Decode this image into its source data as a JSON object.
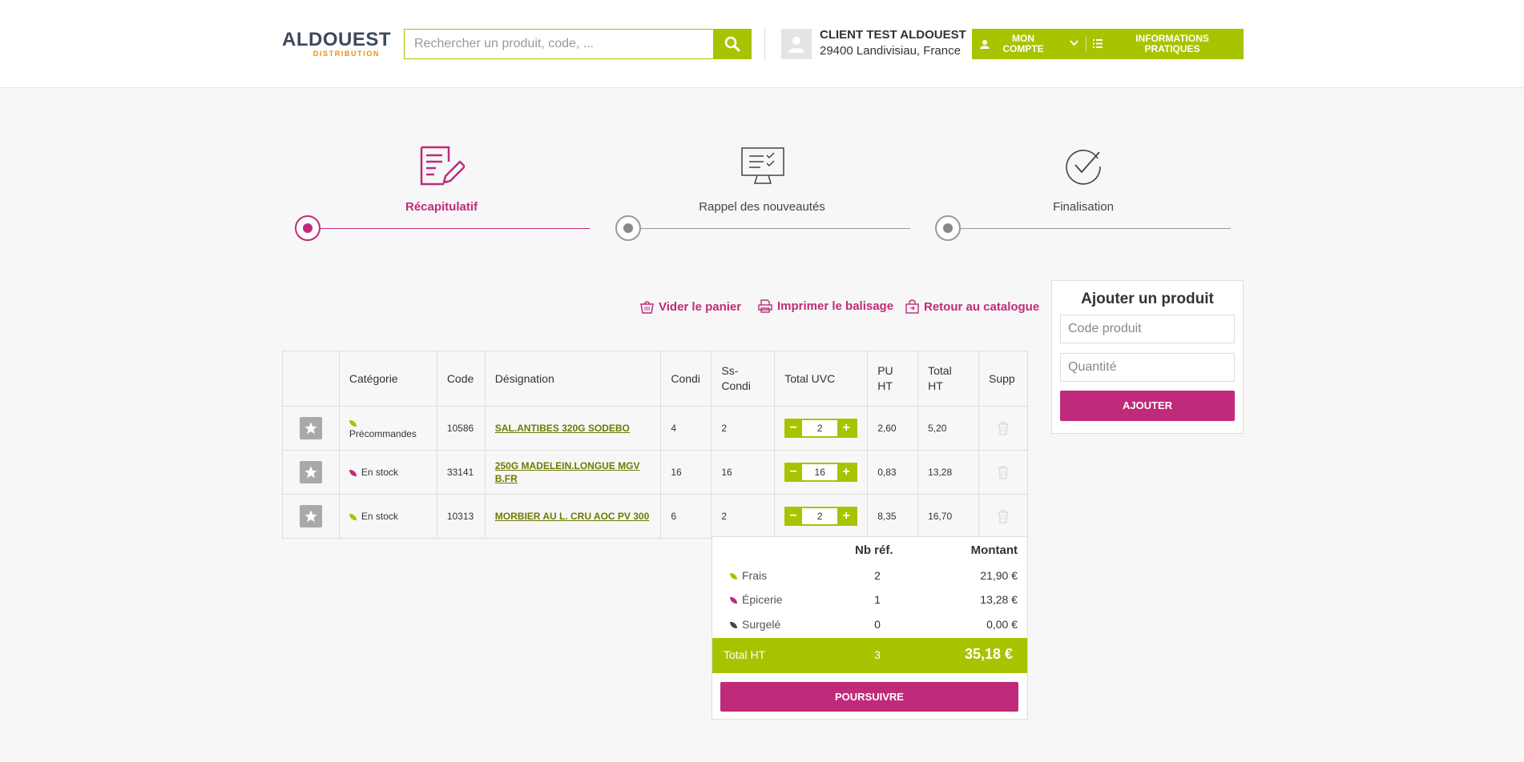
{
  "header": {
    "logo_main": "ALDOUEST",
    "logo_sub": "DISTRIBUTION",
    "search_placeholder": "Rechercher un produit, code, ...",
    "client_name": "CLIENT TEST ALDOUEST",
    "client_address": "29400 Landivisiau, France",
    "account_label": "MON COMPTE",
    "info_label": "INFORMATIONS PRATIQUES"
  },
  "steps": [
    {
      "label": "Récapitulatif",
      "active": true
    },
    {
      "label": "Rappel des nouveautés",
      "active": false
    },
    {
      "label": "Finalisation",
      "active": false
    }
  ],
  "actions": {
    "empty_cart": "Vider le panier",
    "print_labels": "Imprimer le balisage",
    "back_catalog": "Retour au catalogue"
  },
  "table": {
    "headers": [
      "",
      "Catégorie",
      "Code",
      "Désignation",
      "Condi",
      "Ss-Condi",
      "Total UVC",
      "PU HT",
      "Total HT",
      "Supp"
    ],
    "rows": [
      {
        "category": "Précommandes",
        "category_color": "#a8c300",
        "code": "10586",
        "designation": "SAL.ANTIBES 320G SODEBO",
        "condi": "4",
        "ss_condi": "2",
        "qty": "2",
        "pu_ht": "2,60",
        "total_ht": "5,20"
      },
      {
        "category": "En stock",
        "category_color": "#bf2b7a",
        "code": "33141",
        "designation": "250G MADELEIN.LONGUE MGV B.FR",
        "condi": "16",
        "ss_condi": "16",
        "qty": "16",
        "pu_ht": "0,83",
        "total_ht": "13,28"
      },
      {
        "category": "En stock",
        "category_color": "#a8c300",
        "code": "10313",
        "designation": "MORBIER AU L. CRU AOC PV 300",
        "condi": "6",
        "ss_condi": "2",
        "qty": "2",
        "pu_ht": "8,35",
        "total_ht": "16,70"
      }
    ]
  },
  "summary": {
    "col_nb": "Nb réf.",
    "col_amount": "Montant",
    "rows": [
      {
        "label": "Frais",
        "color": "#a8c300",
        "nb": "2",
        "amount": "21,90 €"
      },
      {
        "label": "Épicerie",
        "color": "#bf2b7a",
        "nb": "1",
        "amount": "13,28 €"
      },
      {
        "label": "Surgelé",
        "color": "#3c4a5a",
        "nb": "0",
        "amount": "0,00 €"
      }
    ],
    "total_label": "Total HT",
    "total_nb": "3",
    "total_amount": "35,18 €",
    "continue_label": "POURSUIVRE"
  },
  "add_product": {
    "title": "Ajouter un produit",
    "code_placeholder": "Code produit",
    "qty_placeholder": "Quantité",
    "add_label": "AJOUTER"
  },
  "colors": {
    "green": "#a8c300",
    "pink": "#bf2b7a",
    "logo_orange": "#f08c00"
  }
}
